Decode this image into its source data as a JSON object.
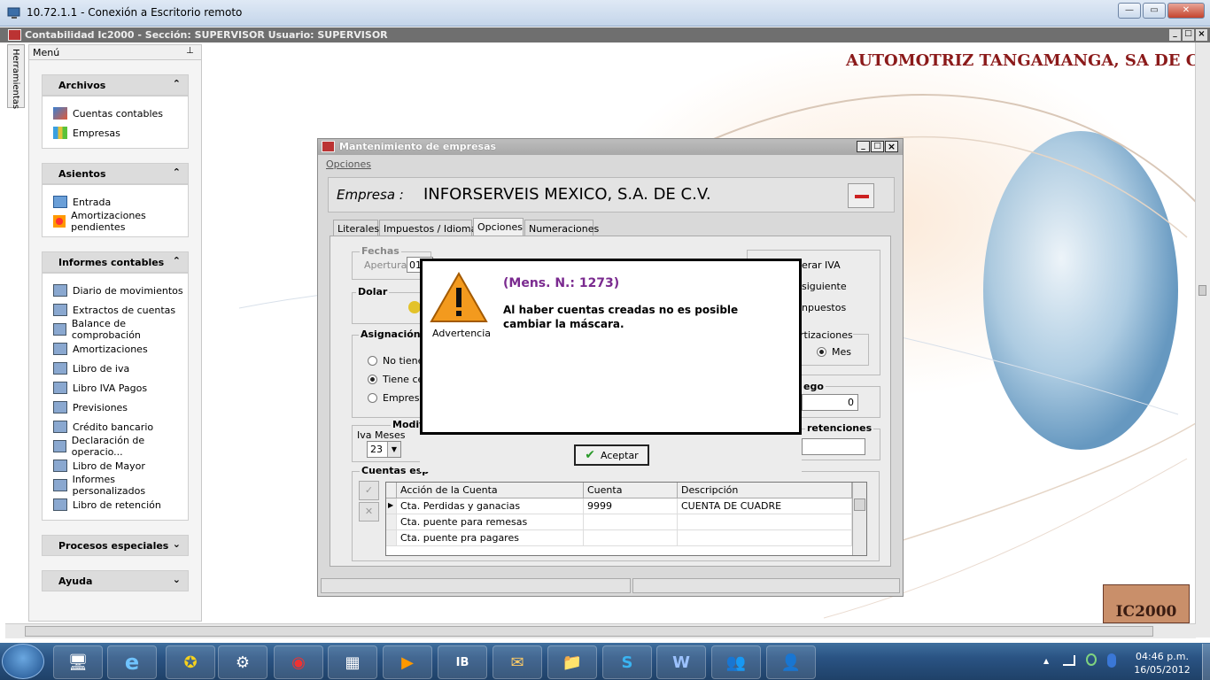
{
  "rdp": {
    "title": "10.72.1.1 - Conexión a Escritorio remoto",
    "btn_minimize": "—",
    "btn_restore": "▭",
    "btn_close": "✕"
  },
  "app": {
    "title": "Contabilidad Ic2000   -   Sección: SUPERVISOR Usuario: SUPERVISOR",
    "company_banner": "AUTOMOTRIZ TANGAMANGA, SA DE C",
    "logo_text": "IC2000",
    "inner_min": "_",
    "inner_restore": "□",
    "inner_close": "×"
  },
  "sidebar": {
    "tools_tab": "Herramientas",
    "menu_title": "Menú",
    "pin": "⊥",
    "groups": [
      {
        "label": "Archivos",
        "items": [
          "Cuentas contables",
          "Empresas"
        ]
      },
      {
        "label": "Asientos",
        "items": [
          "Entrada",
          "Amortizaciones pendientes"
        ]
      },
      {
        "label": "Informes contables",
        "items": [
          "Diario de movimientos",
          "Extractos de cuentas",
          "Balance de comprobación",
          "Amortizaciones",
          "Libro de iva",
          "Libro IVA Pagos",
          "Previsiones",
          "Crédito bancario",
          "Declaración de operacio...",
          "Libro de Mayor",
          "Informes personalizados",
          "Libro de retención"
        ]
      },
      {
        "label": "Procesos especiales",
        "items": []
      },
      {
        "label": "Ayuda",
        "items": []
      }
    ],
    "collapse_icon": "⌃",
    "expand_icon": "⌄"
  },
  "mwin": {
    "title": "Mantenimiento de empresas",
    "menu_opciones": "Opciones",
    "empresa_label": "Empresa :",
    "empresa_value": "INFORSERVEIS MEXICO, S.A. DE C.V.",
    "tabs": [
      "Literales",
      "Impuestos / Idiomas",
      "Opciones",
      "Numeraciones"
    ],
    "active_tab": "Opciones",
    "fechas_label": "Fechas",
    "apertura_label": "Apertura",
    "apertura_value": "01",
    "dolar_label": "Dolar",
    "asignacion_label": "Asignación",
    "radio_no_tiene": "No tiene",
    "radio_tiene_ce": "Tiene ce",
    "radio_empresa": "Empresa",
    "modif_label": "Modif",
    "iva_meses_label": "Iva Meses",
    "iva_meses_value": "23",
    "right_iva": "erar IVA",
    "right_siguiente": "siguiente",
    "right_impuestos": "npuestos",
    "amortizaciones_label": "rtizaciones",
    "mes_label": "Mes",
    "ego_label": "ego",
    "ego_value": "0",
    "retenciones_label": "retenciones",
    "cuentas_label": "Cuentas esp",
    "grid_headers": [
      "Acción de la Cuenta",
      "Cuenta",
      "Descripción"
    ],
    "grid_rows": [
      {
        "accion": "Cta. Perdidas y ganacias",
        "cuenta": "9999",
        "descripcion": "CUENTA DE CUADRE"
      },
      {
        "accion": "Cta. puente para remesas",
        "cuenta": "",
        "descripcion": ""
      },
      {
        "accion": "Cta. puente pra pagares",
        "cuenta": "",
        "descripcion": ""
      }
    ]
  },
  "dialog": {
    "msg_number": "(Mens. N.: 1273)",
    "msg_line1": "Al haber cuentas creadas no es posible",
    "msg_line2": "cambiar la máscara.",
    "warning_label": "Advertencia",
    "accept_button": "Aceptar",
    "accept_icon": "✔"
  },
  "taskbar": {
    "time": "04:46 p.m.",
    "date": "16/05/2012",
    "apps": [
      "remote-desktop-icon",
      "internet-explorer-icon",
      "ic2000-icon",
      "settings-icon",
      "chrome-icon",
      "calculator-icon",
      "media-player-icon",
      "ib-icon",
      "outlook-icon",
      "explorer-icon",
      "skype-icon",
      "word-icon",
      "network-icon",
      "users-icon"
    ],
    "app_glyphs": [
      "🖥",
      "e",
      "✪",
      "⚙",
      "◉",
      "▦",
      "▶",
      "IB",
      "✉",
      "📁",
      "S",
      "W",
      "👥",
      "👤"
    ],
    "tray_up": "▲"
  },
  "colors": {
    "company_banner": "#8b1a1a",
    "msg_number": "#7a2a8f",
    "taskbar": "#2a5383"
  }
}
